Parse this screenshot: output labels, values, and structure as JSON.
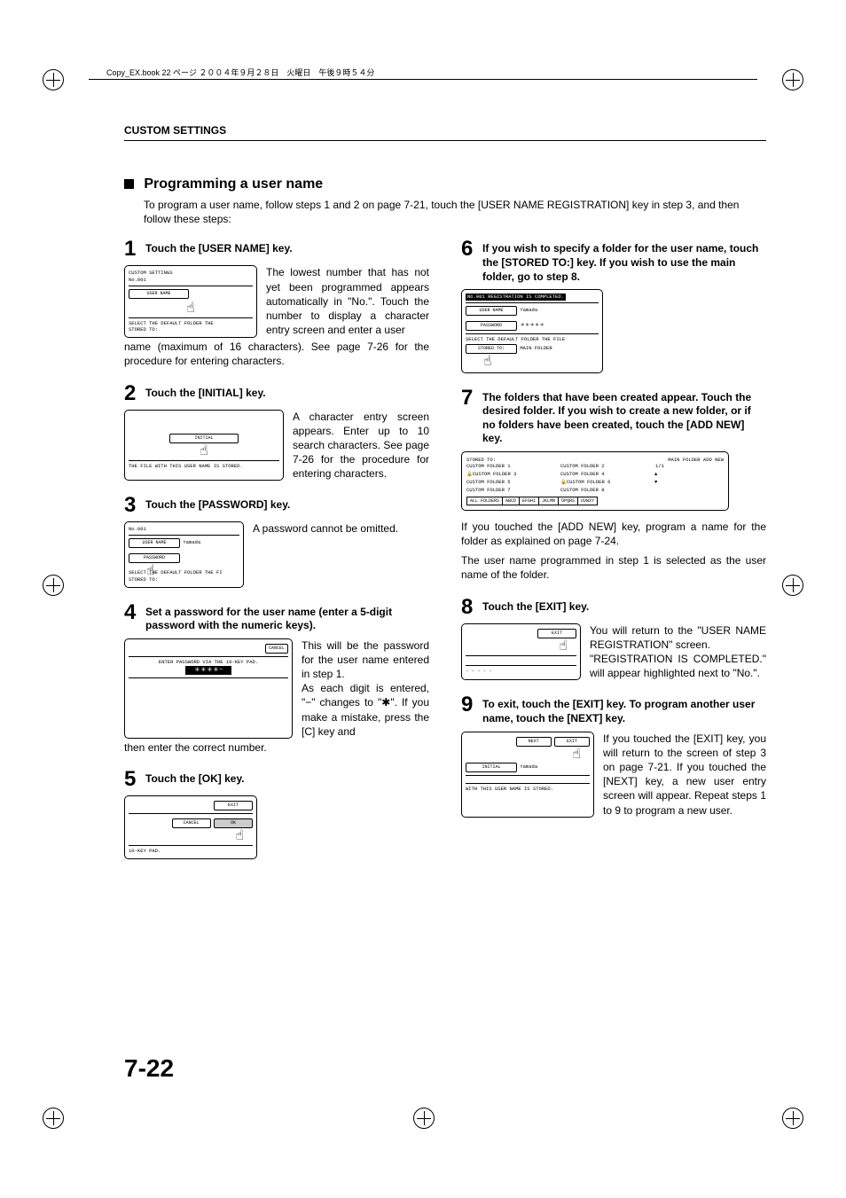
{
  "header": {
    "crop_text": "Copy_EX.book  22 ページ  ２００４年９月２８日　火曜日　午後９時５４分",
    "section": "CUSTOM SETTINGS"
  },
  "title": "Programming a user name",
  "intro": "To program a user name, follow steps 1 and 2 on page 7-21, touch the [USER NAME REGISTRATION] key in step 3, and then follow these steps:",
  "steps": {
    "s1": {
      "num": "1",
      "title": "Touch the [USER NAME] key.",
      "text": "The lowest number that has not yet been programmed appears automatically in \"No.\". Touch the number to display a character entry screen and enter a user name (maximum of 16 characters). See page 7-26 for the procedure for entering characters.",
      "screen": {
        "l1": "CUSTOM SETTINGS",
        "l2": "No.001",
        "btn1": "USER NAME",
        "l3": "SELECT THE DEFAULT FOLDER THE",
        "l4": "STORED TO:"
      }
    },
    "s2": {
      "num": "2",
      "title": "Touch the [INITIAL] key.",
      "text": "A character entry screen appears. Enter up to 10 search characters. See page 7-26 for the procedure for entering characters.",
      "screen": {
        "btn1": "INITIAL",
        "l1": "THE FILE WITH THIS USER NAME IS STORED."
      }
    },
    "s3": {
      "num": "3",
      "title": "Touch the [PASSWORD] key.",
      "text": "A password cannot be omitted.",
      "screen": {
        "l1": "No.001",
        "btn1": "USER NAME",
        "val1": "Yamada",
        "btn2": "PASSWORD",
        "l2": "SELECT THE DEFAULT FOLDER THE FI",
        "l3": "STORED TO:"
      }
    },
    "s4": {
      "num": "4",
      "title": "Set a password for the user name (enter a 5-digit password with the numeric keys).",
      "text": "This will be the password for the user name entered in step 1.\nAs each digit is entered, \"−\" changes to \"✱\". If you make a mistake, press the [C] key and then enter the correct number.",
      "screen": {
        "btn1": "CANCEL",
        "l1": "ENTER PASSWORD VIA THE 10-KEY PAD.",
        "val1": "＊＊＊＊−"
      }
    },
    "s5": {
      "num": "5",
      "title": "Touch the [OK] key.",
      "screen": {
        "btn1": "EXIT",
        "btn2": "CANCEL",
        "btn3": "OK",
        "l1": "10-KEY PAD."
      }
    },
    "s6": {
      "num": "6",
      "title": "If you wish to specify a folder for the user name, touch the [STORED TO:] key. If you wish to use the main folder, go to step 8.",
      "screen": {
        "l1": "No.001 REGISTRATION IS COMPLETED.",
        "btn1": "USER NAME",
        "val1": "Yamada",
        "btn2": "PASSWORD",
        "val2": "＊＊＊＊＊",
        "l2": "SELECT THE DEFAULT FOLDER THE FILE",
        "btn3": "STORED TO:",
        "val3": "MAIN FOLDER"
      }
    },
    "s7": {
      "num": "7",
      "title": "The folders that have been created appear. Touch the desired folder. If you wish to create a new folder, or if no folders have been created, touch the [ADD NEW] key.",
      "text1": "If you touched the [ADD NEW] key, program a name for the folder as explained on page 7-24.",
      "text2": "The user name programmed in step 1 is selected as the user name of the folder.",
      "screen": {
        "l1": "STORED TO:",
        "btn_main": "MAIN FOLDER",
        "btn_add": "ADD NEW",
        "f1": "CUSTOM FOLDER 1",
        "f2": "CUSTOM FOLDER 2",
        "f3": "CUSTOM FOLDER 3",
        "f4": "CUSTOM FOLDER 4",
        "f5": "CUSTOM FOLDER 5",
        "f6": "CUSTOM FOLDER 6",
        "f7": "CUSTOM FOLDER 7",
        "f8": "CUSTOM FOLDER 8",
        "page": "1/1",
        "t1": "ALL FOLDERS",
        "t2": "ABCD",
        "t3": "EFGHI",
        "t4": "JKLMN",
        "t5": "OPQRS",
        "t6": "UVWXY"
      }
    },
    "s8": {
      "num": "8",
      "title": "Touch the [EXIT] key.",
      "text": "You will return to the \"USER NAME REGISTRATION\" screen.\n\"REGISTRATION IS COMPLETED.\" will appear highlighted next to \"No.\".",
      "screen": {
        "btn1": "EXIT",
        "l1": "- - - - -"
      }
    },
    "s9": {
      "num": "9",
      "title": "To exit, touch the [EXIT] key. To program another user name, touch the [NEXT] key.",
      "text": "If you touched the [EXIT] key, you will return to the screen of step 3 on page 7-21. If you touched the [NEXT] key, a new user entry screen will appear. Repeat steps 1 to 9 to program a new user.",
      "screen": {
        "btn1": "NEXT",
        "btn2": "EXIT",
        "btn3": "INITIAL",
        "val1": "Yamada",
        "l1": "WITH THIS USER NAME IS STORED."
      }
    }
  },
  "page_num": "7-22"
}
